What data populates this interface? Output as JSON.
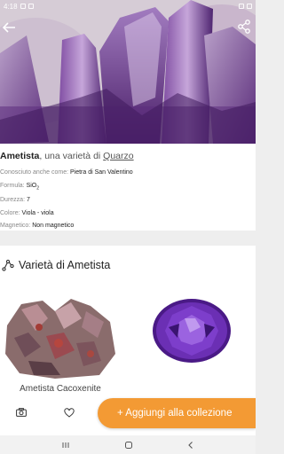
{
  "status_bar": {
    "time": "4:18"
  },
  "hero": {
    "image": "amethyst-crystal-photo"
  },
  "mineral": {
    "name": "Ametista",
    "subtitle": ", una varietà di",
    "parent_link": "Quarzo",
    "properties": [
      {
        "key": "Conosciuto anche come:",
        "value": "Pietra di San Valentino"
      },
      {
        "key": "Formula:",
        "value": "SiO",
        "value_sub": "2"
      },
      {
        "key": "Durezza:",
        "value": "7"
      },
      {
        "key": "Colore:",
        "value": "Viola - viola"
      },
      {
        "key": "Magnetico:",
        "value": "Non magnetico"
      }
    ]
  },
  "varieties": {
    "title": "Varietà di Ametista",
    "cards": [
      {
        "label": "Ametista Cacoxenite",
        "image": "cacoxenite-amethyst-photo"
      },
      {
        "label": "",
        "image": "faceted-amethyst-photo"
      }
    ]
  },
  "bottom_bar": {
    "add_label": "+ Aggiungi alla collezione"
  },
  "colors": {
    "accent": "#f39a34",
    "amethyst": "#6b2fa0"
  }
}
